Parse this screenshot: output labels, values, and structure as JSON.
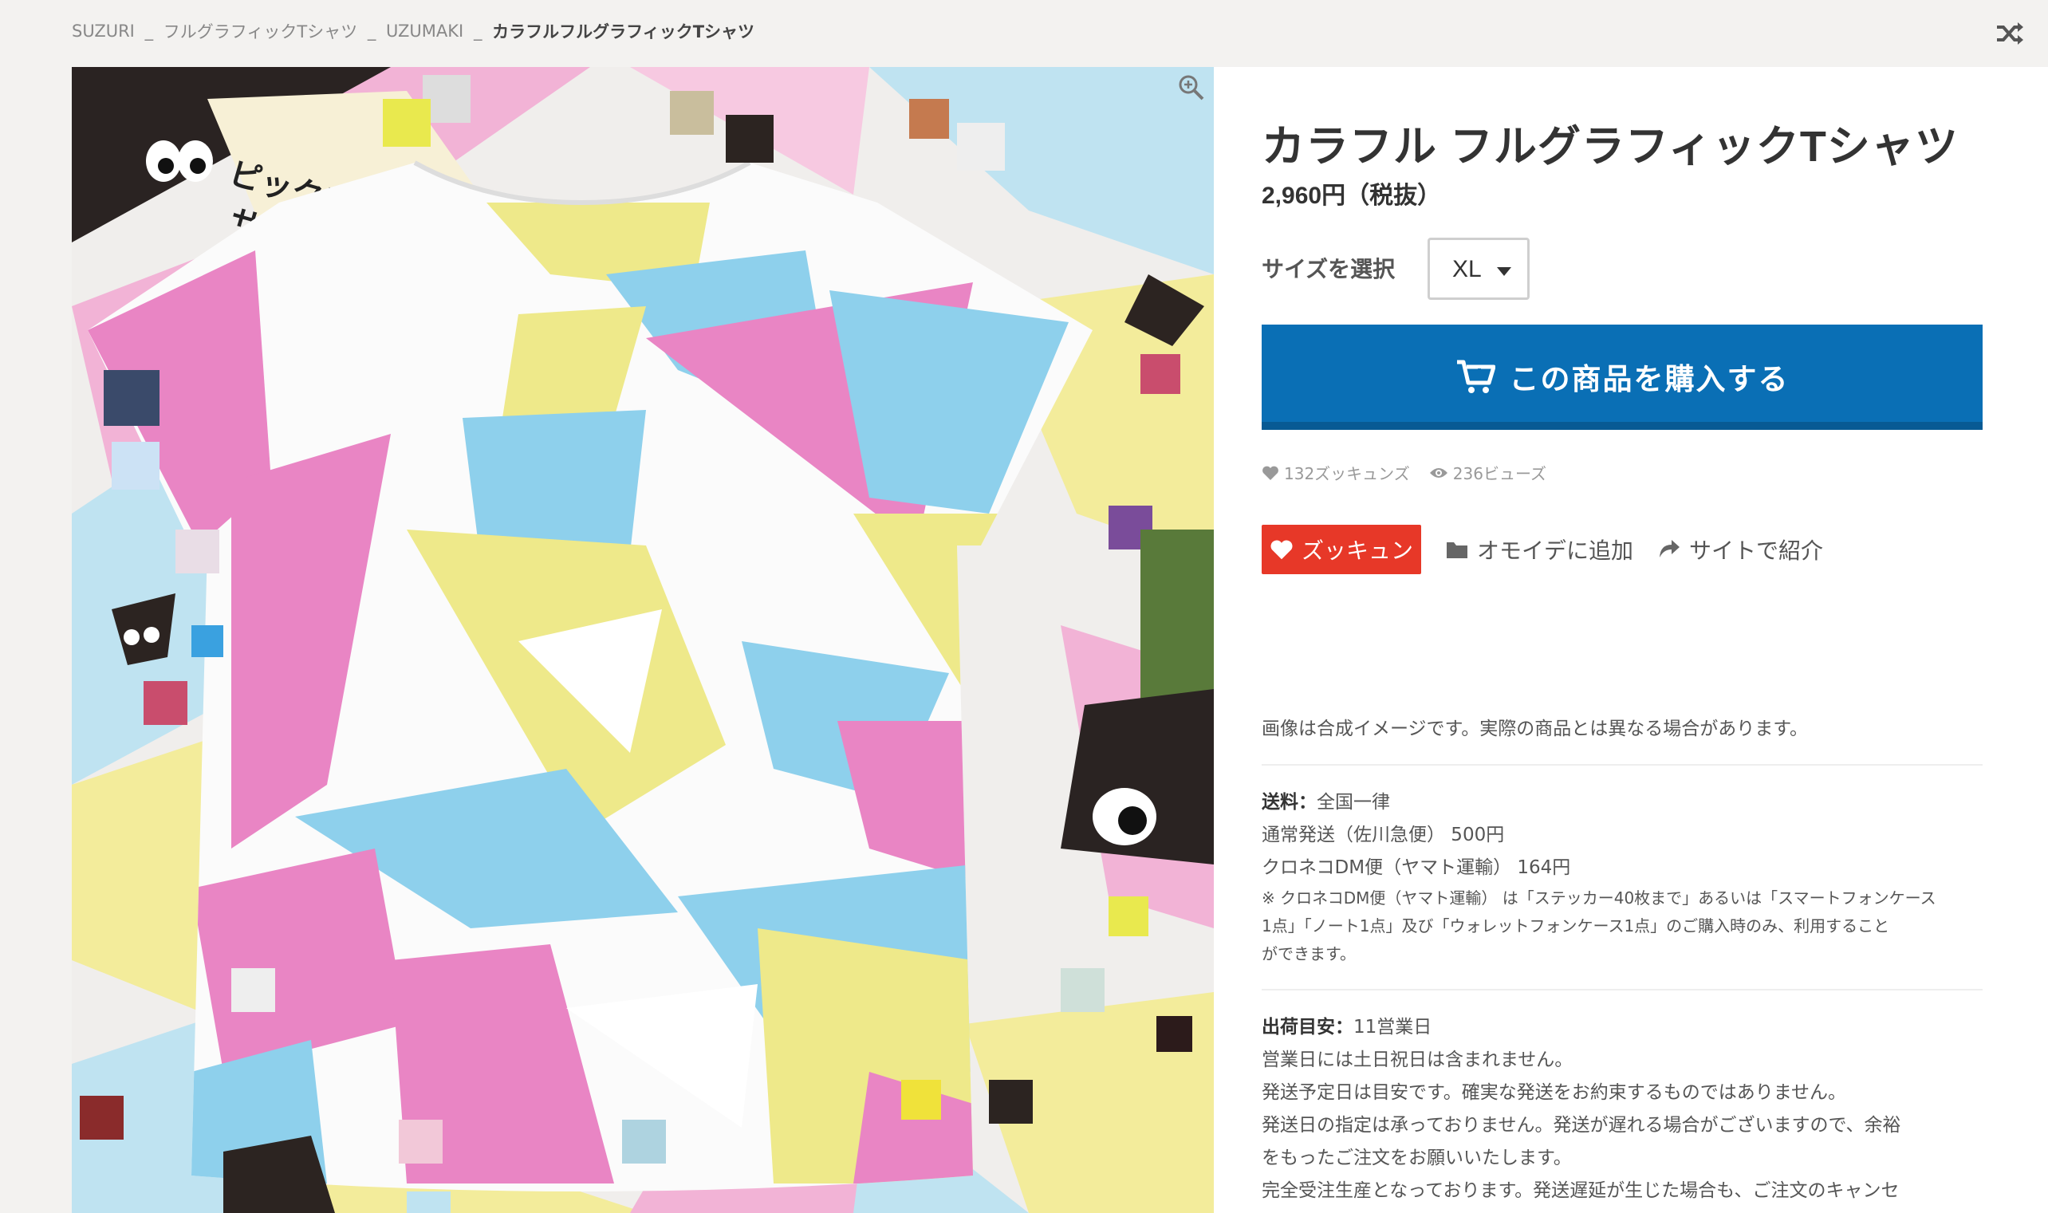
{
  "breadcrumb": {
    "items": [
      "SUZURI",
      "フルグラフィックTシャツ",
      "UZUMAKI"
    ],
    "separator": "_",
    "current": "カラフルフルグラフィックTシャツ"
  },
  "product": {
    "title": "カラフル フルグラフィックTシャツ",
    "price": "2,960円（税抜）"
  },
  "size": {
    "label": "サイズを選択",
    "selected": "XL"
  },
  "buy_button": {
    "label": "この商品を購入する"
  },
  "stats": {
    "likes": "132ズッキュンズ",
    "views": "236ビューズ"
  },
  "actions": {
    "like": "ズッキュン",
    "add_to_memory": "オモイデに追加",
    "share": "サイトで紹介"
  },
  "hero": {
    "pickup_line1": "ピックアップ",
    "pickup_line2": "サレタヨ！"
  },
  "note": "画像は合成イメージです。実際の商品とは異なる場合があります。",
  "shipping": {
    "fee_label": "送料：",
    "fee_value": "全国一律",
    "normal": "通常発送（佐川急便） 500円",
    "dm": "クロネコDM便（ヤマト運輸） 164円",
    "note_line1": "※ クロネコDM便（ヤマト運輸） は「ステッカー40枚まで」あるいは「スマートフォンケース",
    "note_line2": "1点」「ノート1点」及び「ウォレットフォンケース1点」のご購入時のみ、利用すること",
    "note_line3": "ができます。"
  },
  "eta": {
    "label": "出荷目安：",
    "value": "11営業日",
    "line1": "営業日には土日祝日は含まれません。",
    "line2": "発送予定日は目安です。確実な発送をお約束するものではありません。",
    "line3": "発送日の指定は承っておりません。発送が遅れる場合がございますので、余裕",
    "line4": "をもったご注文をお願いいたします。",
    "line5": "完全受注生産となっております。発送遅延が生じた場合も、ご注文のキャンセ"
  },
  "colors": {
    "buy_blue": "#0a6fb5",
    "like_red": "#e73828",
    "pattern_pink": "#e985c4",
    "pattern_blue": "#8ed0ec",
    "pattern_yellow": "#eee98a"
  }
}
